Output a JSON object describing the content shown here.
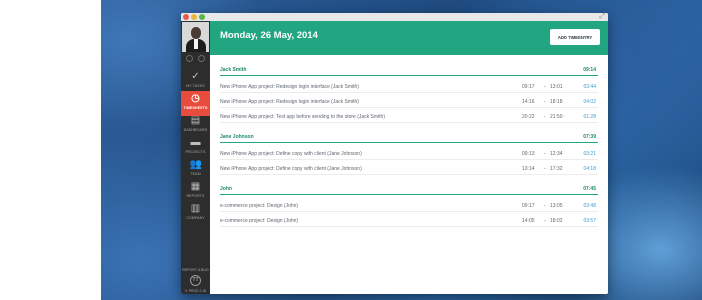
{
  "window": {
    "controls": [
      "close",
      "minimize",
      "maximize"
    ],
    "fullscreen_icon": "expand-arrows-icon",
    "fullscreen_glyph": "⤢"
  },
  "sidebar": {
    "items": [
      {
        "id": "my-tasks",
        "label": "MY TASKS",
        "icon": "checkmark-icon",
        "glyph": "✓",
        "active": false
      },
      {
        "id": "timesheets",
        "label": "TIMESHEETS",
        "icon": "stopwatch-icon",
        "glyph": "◷",
        "active": true
      },
      {
        "id": "dashboard",
        "label": "DASHBOARD",
        "icon": "dashboard-icon",
        "glyph": "▤",
        "active": false
      },
      {
        "id": "projects",
        "label": "PROJECTS",
        "icon": "folder-icon",
        "glyph": "▬",
        "active": false
      },
      {
        "id": "team",
        "label": "TEAM",
        "icon": "team-icon",
        "glyph": "👥",
        "active": false
      },
      {
        "id": "reports",
        "label": "REPORTS",
        "icon": "reports-icon",
        "glyph": "▦",
        "active": false
      },
      {
        "id": "company",
        "label": "COMPANY",
        "icon": "building-icon",
        "glyph": "▥",
        "active": false
      }
    ],
    "report_bug": "REPORT A BUG",
    "bug_glyph": "TT",
    "version": "V. PROD 2.18"
  },
  "header": {
    "date": "Monday, 26 May, 2014",
    "add_button": "ADD TIMEENTRY"
  },
  "groups": [
    {
      "name": "Jack Smith",
      "total": "09:14",
      "entries": [
        {
          "description": "New iPhone App project: Redesign login interface (Jack Smith)",
          "start": "09:17",
          "end": "13:01",
          "duration": "03:44"
        },
        {
          "description": "New iPhone App project: Redesign login interface (Jack Smith)",
          "start": "14:16",
          "end": "18:18",
          "duration": "04:02"
        },
        {
          "description": "New iPhone App project: Test app before sending to the store (Jack Smith)",
          "start": "20:22",
          "end": "21:50",
          "duration": "01:28"
        }
      ]
    },
    {
      "name": "Jane Johnson",
      "total": "07:39",
      "entries": [
        {
          "description": "New iPhone App project: Define copy with client (Jane Johnson)",
          "start": "09:13",
          "end": "12:34",
          "duration": "03:21"
        },
        {
          "description": "New iPhone App project: Define copy with client (Jane Johnson)",
          "start": "13:14",
          "end": "17:32",
          "duration": "04:18"
        }
      ]
    },
    {
      "name": "John",
      "total": "07:45",
      "entries": [
        {
          "description": "e-commerce project: Design (John)",
          "start": "09:17",
          "end": "13:05",
          "duration": "03:48"
        },
        {
          "description": "e-commerce project: Design (John)",
          "start": "14:05",
          "end": "18:02",
          "duration": "03:57"
        }
      ]
    }
  ],
  "colors": {
    "accent": "#22a581",
    "active_nav": "#e84c3d",
    "sidebar_bg": "#2d2d2d",
    "duration": "#3a9fcf"
  }
}
